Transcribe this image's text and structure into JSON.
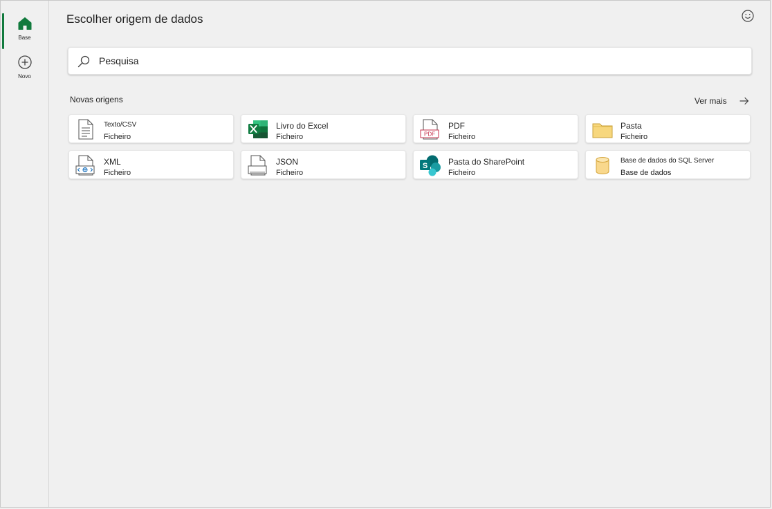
{
  "rail": {
    "items": [
      {
        "label": "Base",
        "icon": "home-icon",
        "active": true
      },
      {
        "label": "Novo",
        "icon": "add-circle-icon",
        "active": false
      }
    ]
  },
  "header": {
    "title": "Escolher origem de dados",
    "feedback_icon": "smiley-icon"
  },
  "search": {
    "placeholder": "Pesquisa",
    "icon": "search-icon"
  },
  "sources": {
    "section_label": "Novas origens",
    "see_more_label": "Ver mais",
    "cards": [
      {
        "name": "Texto/CSV",
        "type": "Ficheiro",
        "icon": "text-file-icon"
      },
      {
        "name": "Livro do Excel",
        "type": "Ficheiro",
        "icon": "excel-icon"
      },
      {
        "name": "PDF",
        "type": "Ficheiro",
        "icon": "pdf-icon"
      },
      {
        "name": "Pasta",
        "type": "Ficheiro",
        "icon": "folder-icon"
      },
      {
        "name": "XML",
        "type": "Ficheiro",
        "icon": "xml-file-icon"
      },
      {
        "name": "JSON",
        "type": "Ficheiro",
        "icon": "json-file-icon"
      },
      {
        "name": "Pasta do SharePoint",
        "type": "Ficheiro",
        "icon": "sharepoint-icon"
      },
      {
        "name": "Base de dados do SQL Server",
        "type": "Base de dados",
        "icon": "database-icon"
      }
    ]
  },
  "colors": {
    "accent": "#117a3d",
    "excel_green": "#107c41",
    "sharepoint_teal": "#038387",
    "folder_yellow": "#f7d77d",
    "pdf_red": "#c4314b",
    "database_yellow": "#f9d88c"
  }
}
